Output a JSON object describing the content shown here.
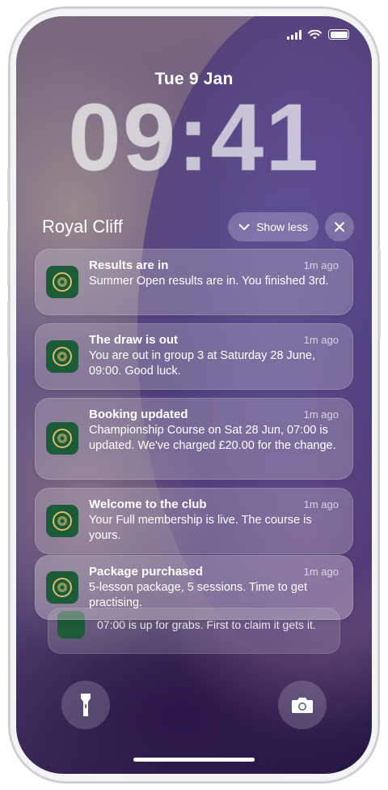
{
  "status_bar": {
    "signal_icon": "cellular-signal-icon",
    "wifi_icon": "wifi-icon",
    "battery_icon": "battery-icon"
  },
  "lock": {
    "date": "Tue 9 Jan",
    "time": "09:41"
  },
  "notification_group": {
    "title": "Royal Cliff",
    "show_less_label": "Show less",
    "chevron_icon": "chevron-down-icon",
    "close_icon": "close-icon"
  },
  "notifications": [
    {
      "title": "Results are in",
      "time": "1m ago",
      "body": "Summer Open results are in. You finished 3rd."
    },
    {
      "title": "The draw is out",
      "time": "1m ago",
      "body": "You are out in group 3 at Saturday 28 June, 09:00. Good luck."
    },
    {
      "title": "Booking updated",
      "time": "1m ago",
      "body": "Championship Course on Sat 28 Jun, 07:00 is updated. We've charged £20.00 for the change."
    },
    {
      "title": "Welcome to the club",
      "time": "1m ago",
      "body": "Your Full membership is live. The course is yours."
    },
    {
      "title": "Package purchased",
      "time": "1m ago",
      "body": "5-lesson package, 5 sessions. Time to get practising."
    }
  ],
  "stacked_notification": {
    "body": "07:00 is up for grabs. First to claim it gets it."
  },
  "quick_actions": {
    "left_icon": "flashlight-icon",
    "right_icon": "camera-icon"
  },
  "colors": {
    "app_icon_bg": "#1d5a37",
    "app_icon_crest": "#d8c06a"
  }
}
